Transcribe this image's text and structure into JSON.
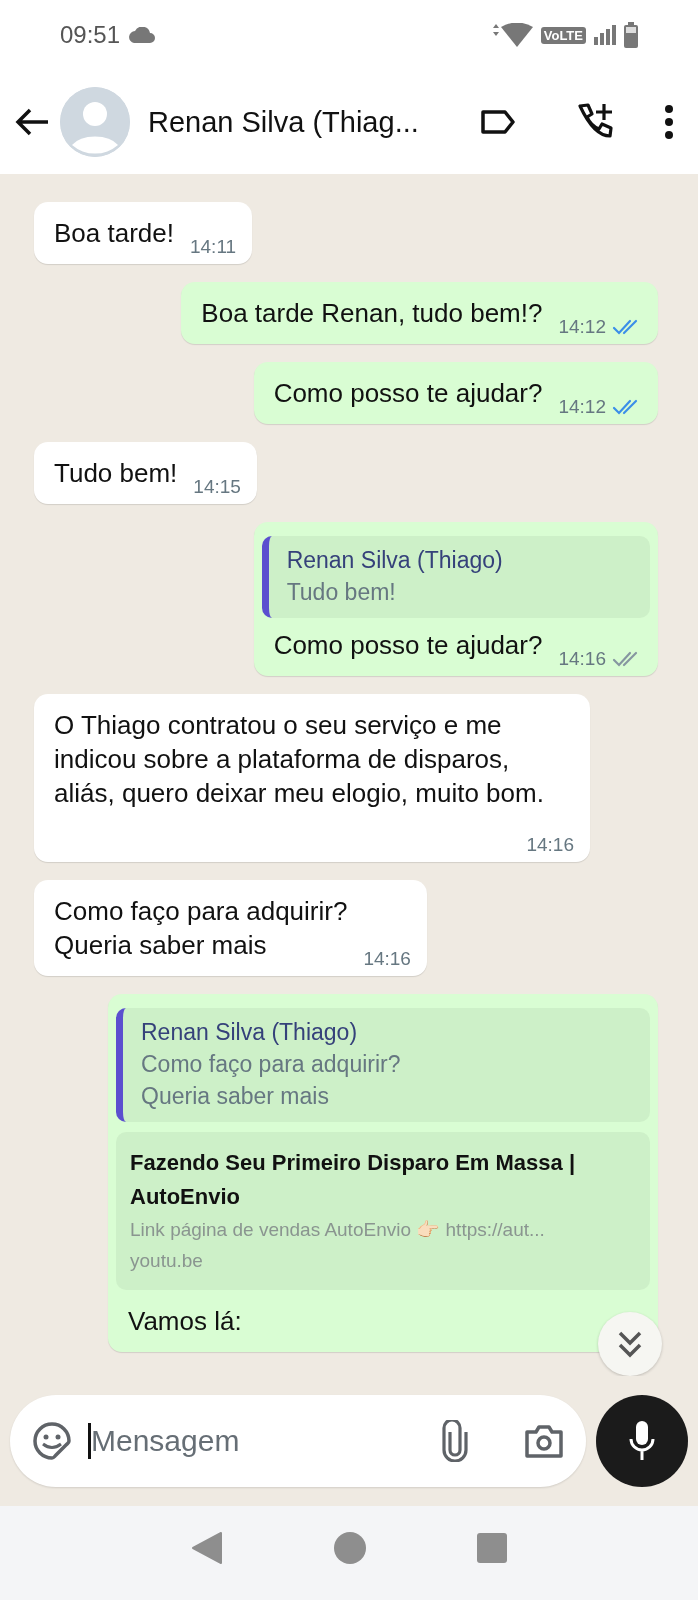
{
  "status_bar": {
    "time": "09:51",
    "volte": "VoLTE"
  },
  "header": {
    "title": "Renan Silva (Thiag..."
  },
  "messages": [
    {
      "kind": "in",
      "text": "Boa tarde!",
      "time": "14:11"
    },
    {
      "kind": "out",
      "text": "Boa tarde Renan, tudo bem!?",
      "time": "14:12",
      "read": true
    },
    {
      "kind": "out",
      "text": "Como posso te ajudar?",
      "time": "14:12",
      "read": true
    },
    {
      "kind": "in",
      "text": "Tudo bem!",
      "time": "14:15"
    },
    {
      "kind": "out",
      "quote": {
        "author": "Renan Silva (Thiago)",
        "text": "Tudo bem!"
      },
      "text": "Como posso te ajudar?",
      "time": "14:16",
      "read": false
    },
    {
      "kind": "in",
      "text": "O Thiago contratou o seu serviço e me indicou sobre a plataforma de disparos, aliás, quero deixar meu elogio, muito bom.",
      "time": "14:16"
    },
    {
      "kind": "in",
      "text": "Como faço para adquirir?\nQueria saber mais",
      "time": "14:16"
    },
    {
      "kind": "out",
      "quote": {
        "author": "Renan Silva (Thiago)",
        "text": "Como faço para adquirir?\nQueria saber mais"
      },
      "link_preview": {
        "title": "Fazendo Seu Primeiro Disparo Em Massa | AutoEnvio",
        "description": "Link página de vendas AutoEnvio 👉🏻 https://aut...",
        "domain": "youtu.be"
      },
      "text": "Vamos lá:"
    }
  ],
  "composer": {
    "placeholder": "Mensagem"
  }
}
